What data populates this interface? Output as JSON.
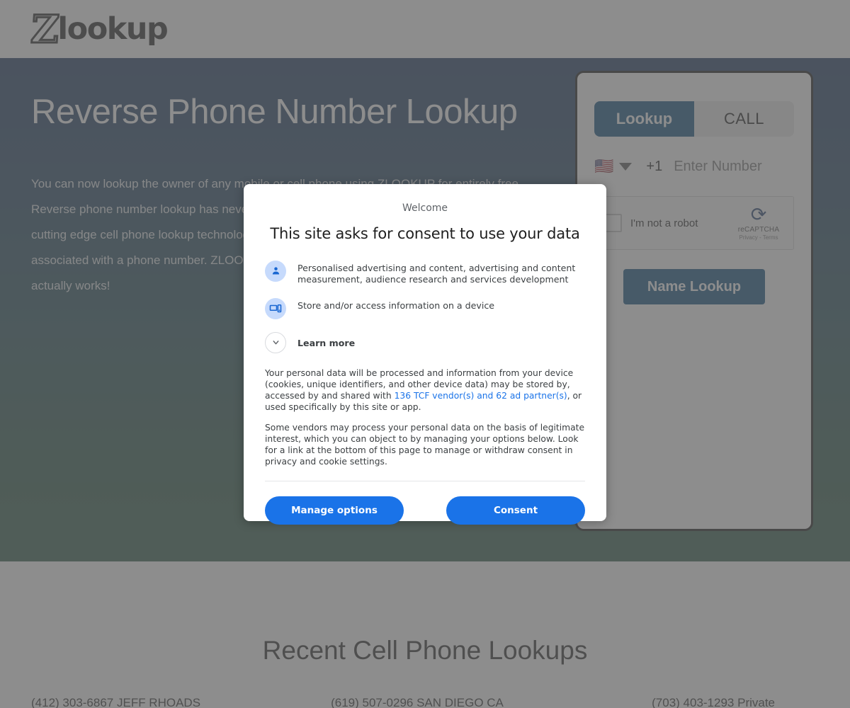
{
  "header": {
    "logo_mark": "Z",
    "logo_word": "lookup"
  },
  "hero": {
    "title": "Reverse Phone Number Lookup",
    "paragraph": "You can now lookup the owner of any mobile or cell phone using ZLOOKUP for entirely free. Reverse phone number lookup has never been more accurate and reliable. ZLOOKUP uses cutting edge cell phone lookup technology to find the owner name of the person or business associated with a phone number. ZLOOKUP is a truly free reverse cell phone lookup - and it actually works!",
    "gradient_top": "#14305c",
    "gradient_bottom": "#265441"
  },
  "lookup_widget": {
    "tabs": [
      {
        "label": "Lookup",
        "active": true
      },
      {
        "label": "CALL",
        "active": false
      }
    ],
    "flag_icon": "us-flag-icon",
    "dial_code": "+1",
    "number_value": "",
    "number_placeholder": "Enter Number",
    "backspace_icon": "backspace-icon",
    "recaptcha": {
      "label": "I'm not a robot",
      "brand": "reCAPTCHA",
      "legal": "Privacy - Terms",
      "checked": false
    },
    "submit_label": "Name Lookup",
    "accent_color": "#07487c"
  },
  "recent": {
    "title": "Recent Cell Phone Lookups",
    "items": [
      "(412) 303-6867 JEFF RHOADS",
      "(619) 507-0296 SAN DIEGO CA",
      "(703) 403-1293 Private"
    ]
  },
  "consent_dialog": {
    "eyebrow": "Welcome",
    "heading": "This site asks for consent to use your data",
    "items": [
      {
        "icon": "person-icon",
        "text": "Personalised advertising and content, advertising and content measurement, audience research and services development"
      },
      {
        "icon": "devices-icon",
        "text": "Store and/or access information on a device"
      },
      {
        "icon": "chevron-down-icon",
        "text": "Learn more"
      }
    ],
    "body_1_before": "Your personal data will be processed and information from your device (cookies, unique identifiers, and other device data) may be stored by, accessed by and shared with ",
    "body_1_link": "136 TCF vendor(s) and 62 ad partner(s)",
    "body_1_after": ", or used specifically by this site or app.",
    "body_2": "Some vendors may process your personal data on the basis of legitimate interest, which you can object to by managing your options below. Look for a link at the bottom of this page to manage or withdraw consent in privacy and cookie settings.",
    "manage_label": "Manage options",
    "consent_label": "Consent",
    "button_color": "#1a73e8",
    "link_color": "#1a73e8"
  }
}
